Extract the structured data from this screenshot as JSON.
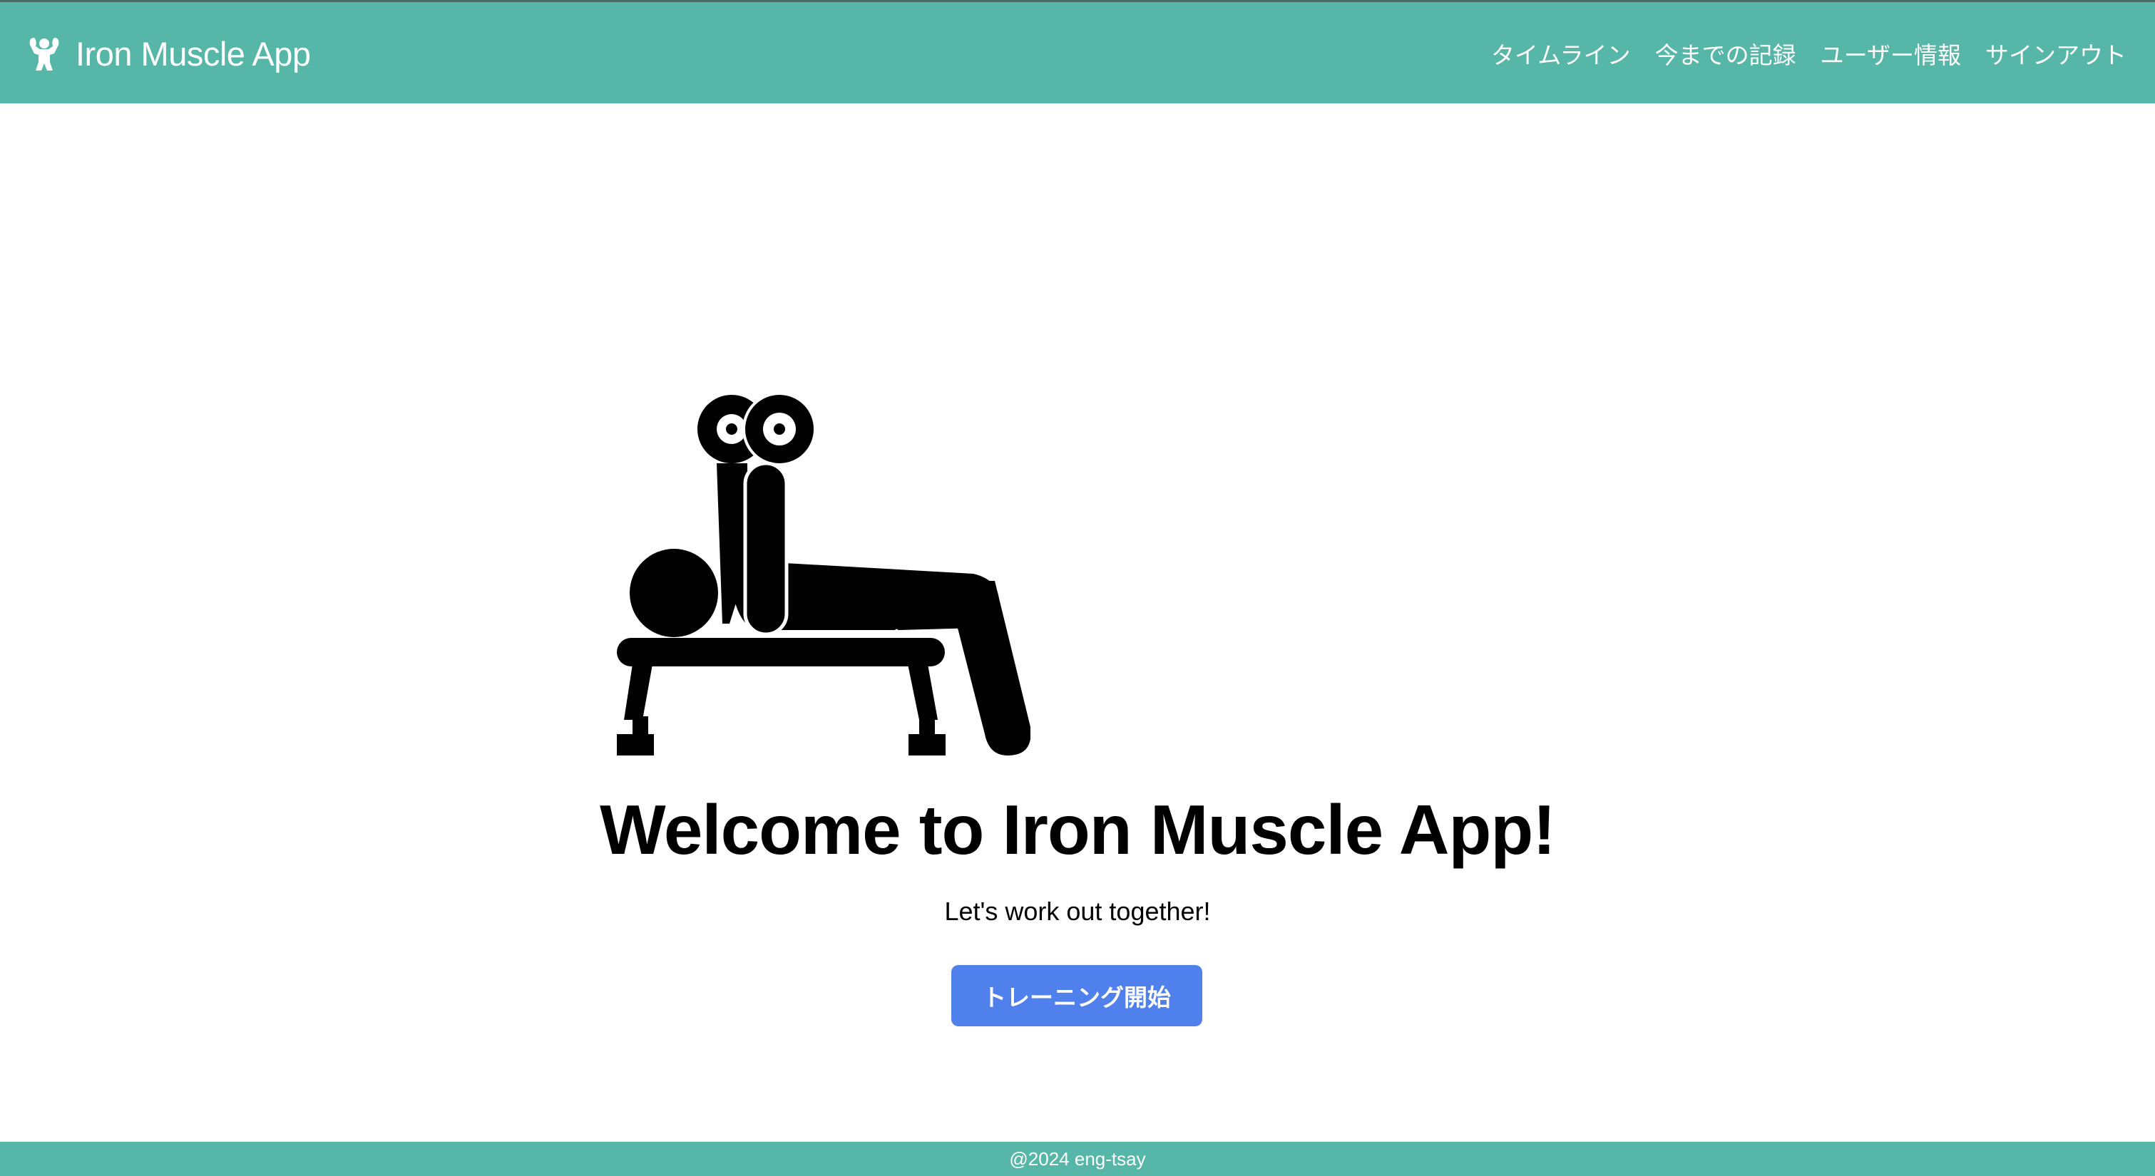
{
  "navbar": {
    "brand": "Iron Muscle App",
    "brand_icon": "flexing-muscle-icon",
    "links": [
      {
        "label": "タイムライン"
      },
      {
        "label": "今までの記録"
      },
      {
        "label": "ユーザー情報"
      },
      {
        "label": "サインアウト"
      }
    ]
  },
  "hero": {
    "illustration": "bench-press-icon",
    "title": "Welcome to Iron Muscle App!",
    "subtitle": "Let's work out together!",
    "button_label": "トレーニング開始"
  },
  "footer": {
    "text": "@2024 eng-tsay"
  },
  "colors": {
    "primary": "#56b6a7",
    "button": "#4f80ec",
    "text": "#000000"
  }
}
